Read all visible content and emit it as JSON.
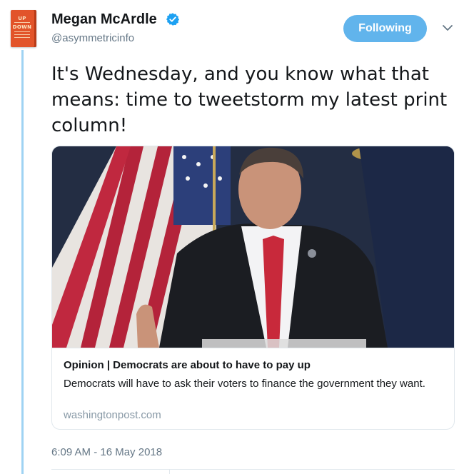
{
  "author": {
    "name": "Megan McArdle",
    "handle": "@asymmetricinfo",
    "avatar_text": [
      "UP",
      "DOWN"
    ],
    "verified_icon": "verified-badge-icon"
  },
  "follow_button": {
    "label": "Following"
  },
  "menu_icon": "chevron-down-icon",
  "tweet": {
    "text": "It's Wednesday, and you know what that means: time to tweetstorm my latest print column!",
    "timestamp": "6:09 AM - 16 May 2018"
  },
  "card": {
    "title": "Opinion | Democrats are about to have to pay up",
    "description": "Democrats will have to ask their voters to finance the government they want.",
    "domain": "washingtonpost.com"
  },
  "colors": {
    "accent": "#1da1f2",
    "follow_button_bg": "#61b4ec",
    "thread_line": "#9fd3f3",
    "muted_text": "#657786"
  }
}
